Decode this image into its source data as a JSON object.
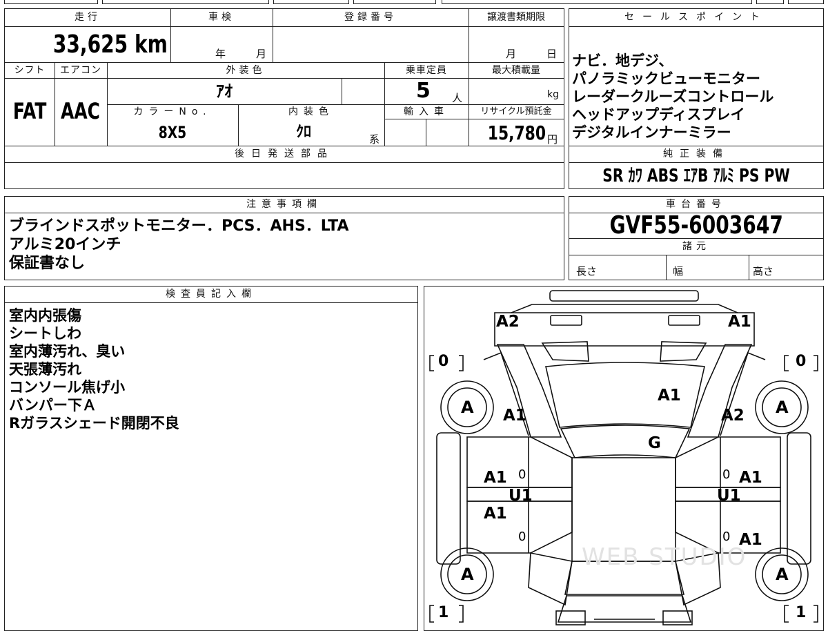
{
  "headers": {
    "mileage": "走行",
    "inspection": "車検",
    "registration_no": "登録番号",
    "transfer_deadline": "譲渡書類期限",
    "sales_points": "セールスポイント",
    "shift": "シフト",
    "aircon": "エアコン",
    "exterior_color": "外装色",
    "capacity": "乗車定員",
    "max_load": "最大積載量",
    "color_no": "カラーNo.",
    "interior_color": "内装色",
    "import": "輸入車",
    "recycle_fee": "リサイクル預託金",
    "later_parts": "後日発送部品",
    "genuine_equipment": "純正装備",
    "notes": "注意事項欄",
    "chassis_no": "車台番号",
    "specs": "諸元",
    "inspector": "検査員記入欄"
  },
  "values": {
    "mileage": "33,625 km",
    "inspection_year_unit": "年",
    "inspection_month_unit": "月",
    "transfer_month_unit": "月",
    "transfer_day_unit": "日",
    "shift": "FAT",
    "aircon": "AAC",
    "exterior_color": "ｱｵ",
    "capacity": "5",
    "capacity_unit": "人",
    "max_load_unit": "kg",
    "color_no": "8X5",
    "interior_color": "ｸﾛ",
    "interior_suffix": "系",
    "recycle_fee": "15,780",
    "recycle_unit": "円",
    "chassis_no": "GVF55-6003647",
    "length_label": "長さ",
    "width_label": "幅",
    "height_label": "高さ"
  },
  "sales_points": [
    "ナビ．地デジ、",
    "パノラミックビューモニター",
    "レーダークルーズコントロール",
    "ヘッドアップディスプレイ",
    "デジタルインナーミラー"
  ],
  "equipment": "SR ｶﾜ ABS ｴｱB ｱﾙﾐ PS PW",
  "notes": [
    "ブラインドスポットモニター．PCS．AHS．LTA",
    "アルミ20インチ",
    "保証書なし"
  ],
  "inspector_notes": [
    "室内内張傷",
    "シートしわ",
    "室内薄汚れ、臭い",
    "天張薄汚れ",
    "コンソール焦げ小",
    "バンパー下Ａ",
    "Rガラスシェード開閉不良"
  ],
  "diagram": {
    "tread_fl": "0",
    "tread_fr": "0",
    "tread_rl": "1",
    "tread_rr": "1",
    "wheel": "A",
    "front_left": "A2",
    "front_right": "A1",
    "hood": "A1",
    "fender_left": "A1",
    "fender_right": "A2",
    "windshield": "G",
    "door_fl": "A1",
    "door_rl": "A1",
    "door_fr": "A1",
    "door_rr": "A1",
    "pillar_left": "U1",
    "pillar_right": "U1",
    "mark_fl": "0",
    "mark_rl": "0",
    "mark_fr": "0",
    "mark_rr": "0",
    "watermark": "WEB STUDIO"
  }
}
